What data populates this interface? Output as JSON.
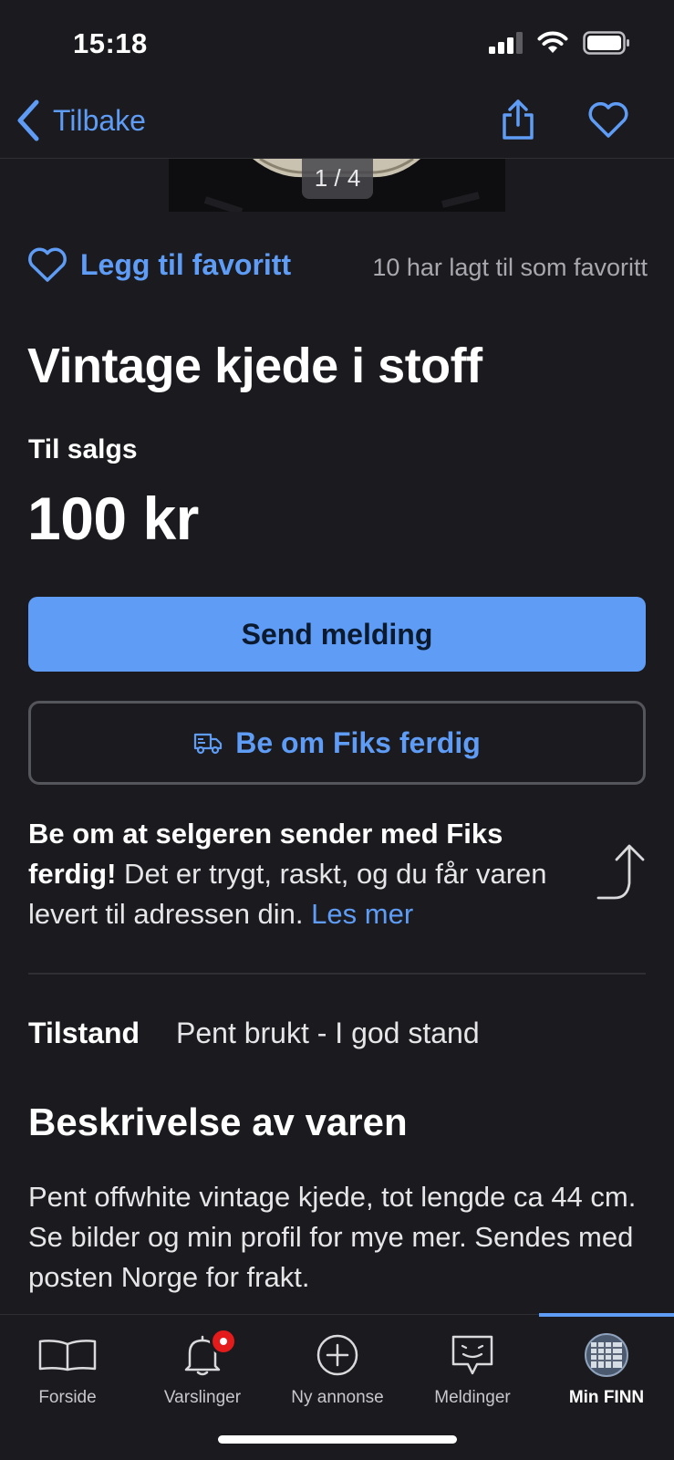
{
  "status_bar": {
    "time": "15:18"
  },
  "nav": {
    "back_label": "Tilbake"
  },
  "image": {
    "counter": "1 / 4"
  },
  "favorite": {
    "label": "Legg til favoritt",
    "count_text": "10 har lagt til som favoritt"
  },
  "listing": {
    "title": "Vintage kjede i stoff",
    "sale_type": "Til salgs",
    "price": "100 kr"
  },
  "actions": {
    "send_message": "Send melding",
    "request_fiks": "Be om Fiks ferdig"
  },
  "fiks_info": {
    "bold_text": "Be om at selgeren sender med Fiks ferdig!",
    "body_text": " Det er trygt, raskt, og du får varen levert til adressen din. ",
    "link_text": "Les mer"
  },
  "condition": {
    "label": "Tilstand",
    "value": "Pent brukt - I god stand"
  },
  "description": {
    "heading": "Beskrivelse av varen",
    "text": "Pent offwhite vintage kjede, tot lengde ca 44 cm. Se bilder og min profil for mye mer. Sendes med posten Norge for frakt."
  },
  "tab_bar": {
    "active": "Min FINN",
    "tabs": [
      {
        "label": "Forside",
        "icon": "book-icon"
      },
      {
        "label": "Varslinger",
        "icon": "bell-icon"
      },
      {
        "label": "Ny annonse",
        "icon": "plus-circle-icon"
      },
      {
        "label": "Meldinger",
        "icon": "chat-icon"
      },
      {
        "label": "Min FINN",
        "icon": "avatar"
      }
    ]
  },
  "colors": {
    "background": "#1b1b1f",
    "accent": "#5e9cf5",
    "badge": "#e41b1b"
  }
}
